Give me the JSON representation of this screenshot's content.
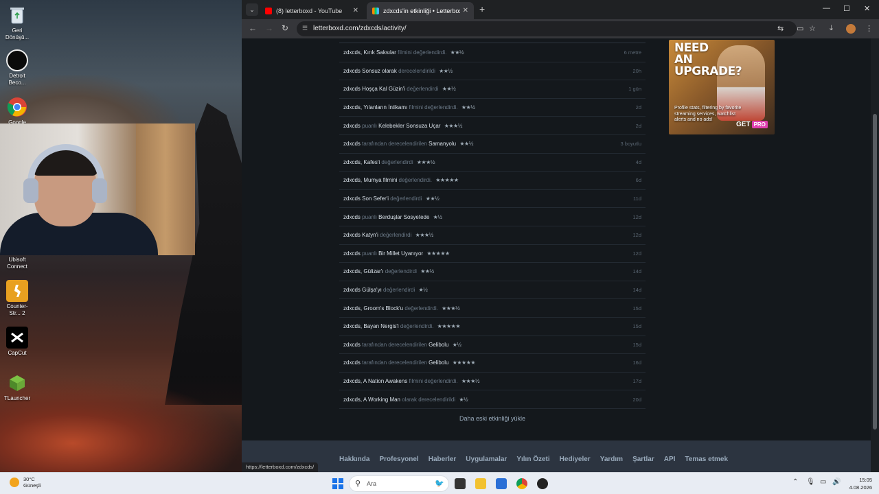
{
  "desktop": {
    "icons": [
      {
        "label": "Geri Dönüşü..."
      },
      {
        "label": "Detroit Beco..."
      },
      {
        "label": "Google"
      },
      {
        "label": "Ubisoft Connect"
      },
      {
        "label": "Counter-Str... 2"
      },
      {
        "label": "CapCut"
      },
      {
        "label": "TLauncher"
      }
    ]
  },
  "browser": {
    "tabs": [
      {
        "title": "(8) letterboxd - YouTube",
        "close": "✕"
      },
      {
        "title": "zdxcds'in etkinliği • Letterboxd",
        "close": "✕"
      }
    ],
    "new_tab": "+",
    "window_controls": {
      "minimize": "—",
      "maximize": "☐",
      "close": "✕"
    },
    "url": "letterboxd.com/zdxcds/activity/",
    "status_url": "https://letterboxd.com/zdxcds/"
  },
  "activity": {
    "rows": [
      {
        "user": "zdxcds,",
        "film": "Kırık Saksılar",
        "mid": "filmini değerlendirdi.",
        "stars": "★★½",
        "time": "6 metre"
      },
      {
        "user": "zdxcds",
        "film": "Sonsuz olarak",
        "mid": "derecelendirildi",
        "stars": "★★½",
        "time": "20h"
      },
      {
        "user": "zdxcds",
        "film": "Hoşça Kal Güzin'i",
        "mid": "değerlendirdi",
        "stars": "★★½",
        "time": "1 gün"
      },
      {
        "user": "zdxcds,",
        "film": "Yılanların İntikamı",
        "mid": "filmini değerlendirdi.",
        "stars": "★★½",
        "time": "2d"
      },
      {
        "user": "zdxcds",
        "mid": "puanlı",
        "film": "Kelebekler Sonsuza Uçar",
        "stars": "★★★½",
        "time": "2d"
      },
      {
        "user": "zdxcds",
        "mid": "tarafından derecelendirilen",
        "film": "Samanyolu",
        "stars": "★★½",
        "time": "3 boyutlu"
      },
      {
        "user": "zdxcds,",
        "film": "Kafes'i",
        "mid": "değerlendirdi",
        "stars": "★★★½",
        "time": "4d"
      },
      {
        "user": "zdxcds,",
        "film": "Mumya filmini",
        "mid": "değerlendirdi.",
        "stars": "★★★★★",
        "time": "6d"
      },
      {
        "user": "zdxcds",
        "film": "Son Sefer'i",
        "mid": "değerlendirdi",
        "stars": "★★½",
        "time": "11d"
      },
      {
        "user": "zdxcds",
        "mid": "puanlı",
        "film": "Berduşlar Sosyetede",
        "stars": "★½",
        "time": "12d"
      },
      {
        "user": "zdxcds",
        "film": "Katyn'i",
        "mid": "değerlendirdi",
        "stars": "★★★½",
        "time": "12d"
      },
      {
        "user": "zdxcds",
        "mid": "puanlı",
        "film": "Bir Millet Uyanıyor",
        "stars": "★★★★★",
        "time": "12d"
      },
      {
        "user": "zdxcds,",
        "film": "Gülizar'ı",
        "mid": "değerlendirdi",
        "stars": "★★½",
        "time": "14d"
      },
      {
        "user": "zdxcds",
        "film": "Gülşa'yı",
        "mid": "değerlendirdi",
        "stars": "★½",
        "time": "14d"
      },
      {
        "user": "zdxcds,",
        "film": "Groom's Block'u",
        "mid": "değerlendirdi.",
        "stars": "★★★½",
        "time": "15d"
      },
      {
        "user": "zdxcds,",
        "film": "Bayan Nergis'i",
        "mid": "değerlendirdi.",
        "stars": "★★★★★",
        "time": "15d"
      },
      {
        "user": "zdxcds",
        "mid": "tarafından derecelendirilen",
        "film": "Gelibolu",
        "stars": "★½",
        "time": "15d"
      },
      {
        "user": "zdxcds",
        "mid": "tarafından derecelendirilen",
        "film": "Gelibolu",
        "stars": "★★★★★",
        "time": "16d"
      },
      {
        "user": "zdxcds,",
        "film": "A Nation Awakens",
        "mid": "filmini değerlendirdi.",
        "stars": "★★★½",
        "time": "17d"
      },
      {
        "user": "zdxcds,",
        "film": "A Working Man",
        "mid": "olarak derecelendirildi",
        "stars": "★½",
        "time": "20d"
      }
    ],
    "load_more": "Daha eski etkinliği yükle"
  },
  "ad": {
    "headline": "NEED AN UPGRADE?",
    "body": "Profile stats, filtering by favorite streaming services, watchlist alerts and no ads!",
    "cta": "GET",
    "cta_badge": "PRO"
  },
  "footer": {
    "links": [
      "Hakkında",
      "Profesyonel",
      "Haberler",
      "Uygulamalar",
      "Yılın Özeti",
      "Hediyeler",
      "Yardım",
      "Şartlar",
      "API",
      "Temas etmek"
    ]
  },
  "taskbar": {
    "weather_temp": "30°C",
    "weather_desc": "Güneşli",
    "search_placeholder": "Ara",
    "time": "15:05",
    "date": "4.08.2026"
  }
}
